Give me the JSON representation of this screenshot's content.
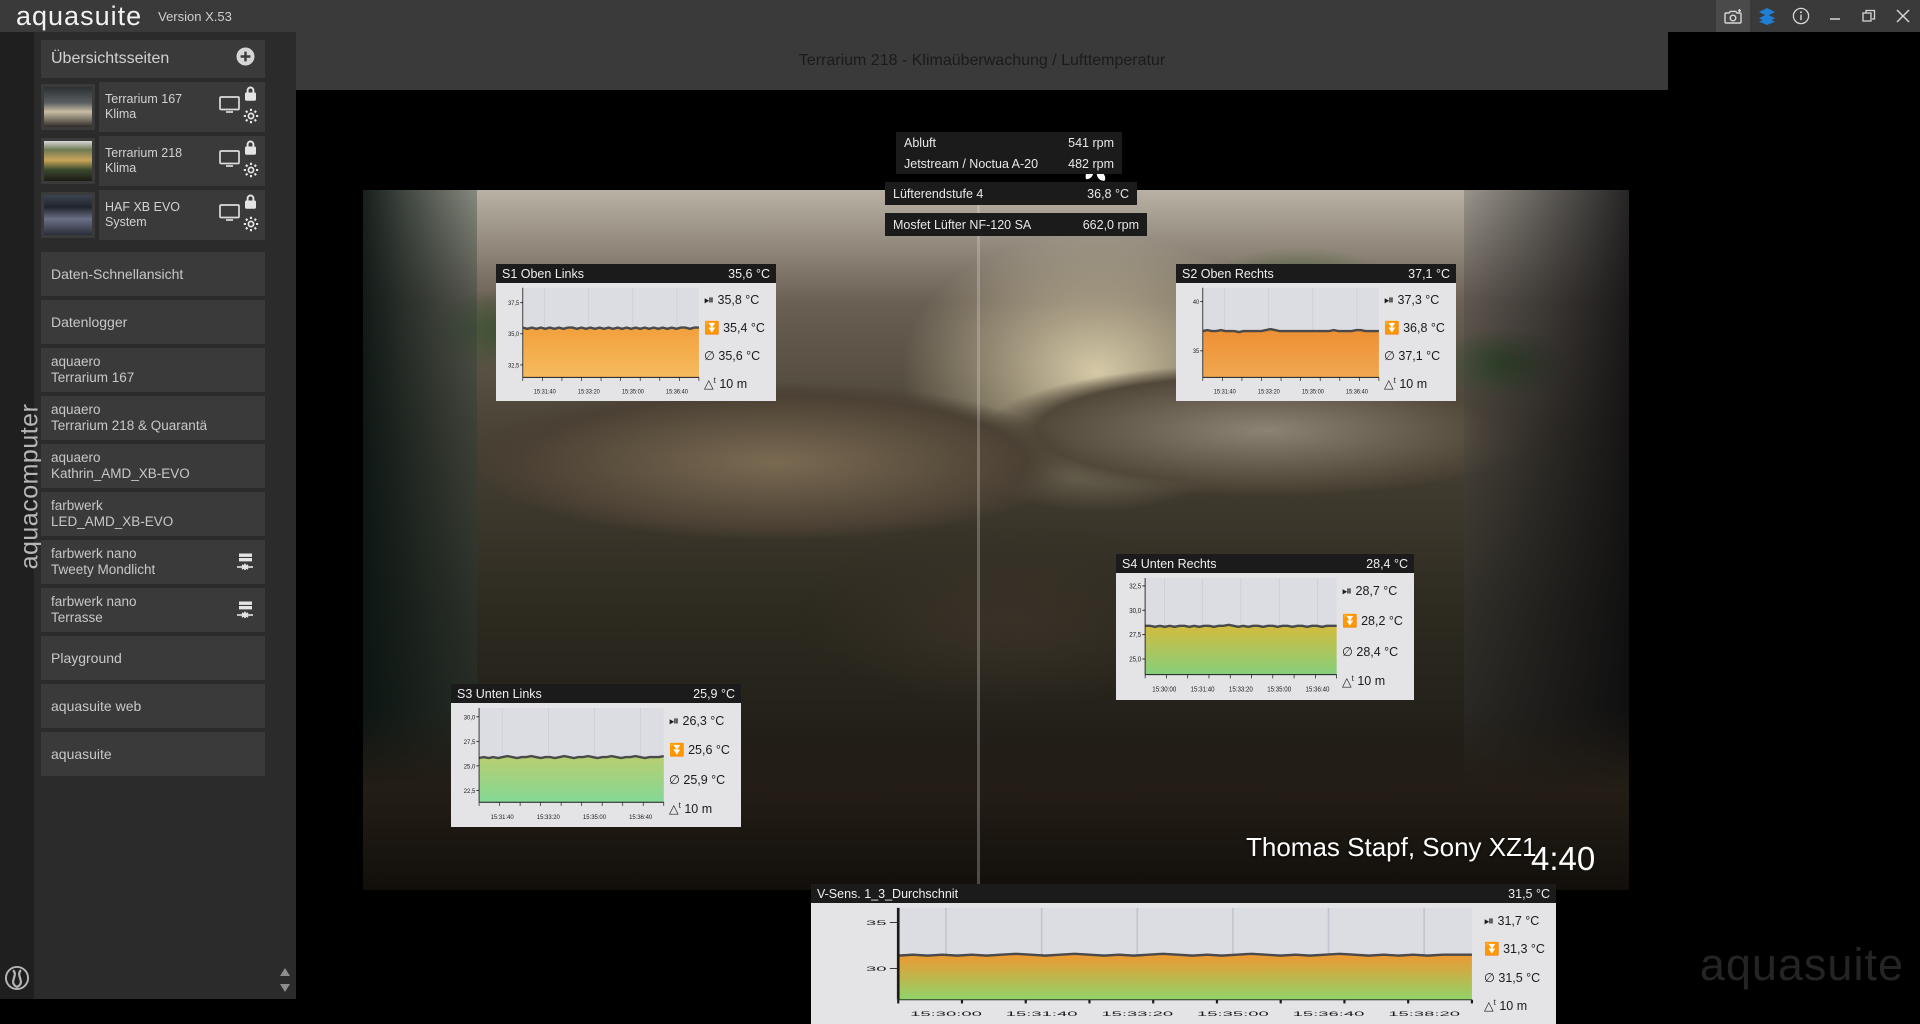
{
  "titlebar": {
    "app_name": "aquasuite",
    "version": "Version X.53",
    "buttons": [
      {
        "name": "screenshot-icon",
        "label": "Screenshot"
      },
      {
        "name": "layers-icon",
        "label": "Ebenen"
      },
      {
        "name": "info-icon",
        "label": "Info"
      },
      {
        "name": "minimize-icon",
        "label": "Minimieren"
      },
      {
        "name": "restore-icon",
        "label": "Wiederherstellen"
      },
      {
        "name": "close-icon",
        "label": "Schliessen"
      }
    ],
    "accent_blue": "#1e7fd4"
  },
  "sidebar": {
    "brand_vertical": "aquacomputer",
    "overview": {
      "title": "Übersichtsseiten",
      "add_label": "+"
    },
    "pages": [
      {
        "title": "Terrarium 167",
        "subtitle": "Klima"
      },
      {
        "title": "Terrarium 218",
        "subtitle": "Klima"
      },
      {
        "title": "HAF XB EVO",
        "subtitle": "System"
      }
    ],
    "sections": [
      {
        "label": "Daten-Schnellansicht"
      },
      {
        "label": "Datenlogger"
      }
    ],
    "devices": [
      {
        "type": "aquaero",
        "name": "Terrarium 167",
        "icon": ""
      },
      {
        "type": "aquaero",
        "name": "Terrarium 218 & Quarantä",
        "icon": ""
      },
      {
        "type": "aquaero",
        "name": "Kathrin_AMD_XB-EVO",
        "icon": ""
      },
      {
        "type": "farbwerk",
        "name": "LED_AMD_XB-EVO",
        "icon": ""
      },
      {
        "type": "farbwerk nano",
        "name": "Tweety Mondlicht",
        "icon": "device-icon"
      },
      {
        "type": "farbwerk nano",
        "name": "Terrasse",
        "icon": "device-icon"
      }
    ],
    "footer": [
      {
        "label": "Playground"
      },
      {
        "label": "aquasuite web"
      },
      {
        "label": "aquasuite"
      }
    ]
  },
  "main": {
    "header_title": "Terrarium 218 - Klimaüberwachung / Lufttemperatur",
    "watermark": "Thomas Stapf, Sony XZ1",
    "clock": "4:40",
    "brand_watermark": "aquasuite",
    "fan_icon": "fan-icon"
  },
  "data_labels": [
    {
      "name": "abluft",
      "label": "Abluft",
      "value": "541 rpm"
    },
    {
      "name": "jetstream",
      "label": "Jetstream / Noctua A-20",
      "value": "482 rpm"
    },
    {
      "name": "luefterendstufe",
      "label": "Lüfterendstufe 4",
      "value": "36,8 °C"
    },
    {
      "name": "mosfet",
      "label": "Mosfet Lüfter NF-120 SA",
      "value": "662,0 rpm"
    }
  ],
  "chart_data": [
    {
      "id": "s1",
      "type": "area",
      "title": "S1 Oben Links",
      "header_value": "35,6 °C",
      "ylabel": "",
      "xlabel": "",
      "yticks": [
        "37,5",
        "35,0",
        "32,5"
      ],
      "ytick_values": [
        37.5,
        35.0,
        32.5
      ],
      "ylim": [
        31.5,
        38.7
      ],
      "xticks": [
        "15:31:40",
        "15:33:20",
        "15:35:00",
        "15:36:40"
      ],
      "values": [
        35.5,
        35.4,
        35.5,
        35.4,
        35.5,
        35.4,
        35.5,
        35.4,
        35.5,
        35.4,
        35.5,
        35.5,
        35.4,
        35.5,
        35.4,
        35.5,
        35.4,
        35.5,
        35.4,
        35.5,
        35.4,
        35.5,
        35.4,
        35.5,
        35.4,
        35.5,
        35.4,
        35.5,
        35.4,
        35.5,
        35.4,
        35.5,
        35.4,
        35.5,
        35.4,
        35.5,
        35.5,
        35.4,
        35.5,
        35.5
      ],
      "stats": {
        "max_label": "35,8 °C",
        "min_label": "35,4 °C",
        "avg_label": "35,6 °C",
        "dt_label": "10 m"
      },
      "gradient": [
        "#f2a03c",
        "#f6bb5e"
      ]
    },
    {
      "id": "s2",
      "type": "area",
      "title": "S2 Oben Rechts",
      "header_value": "37,1 °C",
      "yticks": [
        "40",
        "35"
      ],
      "ytick_values": [
        40,
        35
      ],
      "ylim": [
        32.3,
        41.4
      ],
      "xticks": [
        "15:31:40",
        "15:33:20",
        "15:35:00",
        "15:36:40"
      ],
      "values": [
        37.0,
        37.1,
        37.0,
        37.0,
        37.1,
        37.0,
        37.0,
        37.0,
        36.9,
        37.0,
        37.0,
        37.0,
        37.0,
        37.0,
        37.1,
        37.2,
        37.1,
        37.0,
        37.0,
        37.0,
        37.0,
        37.0,
        37.0,
        37.0,
        37.0,
        37.0,
        37.0,
        37.0,
        37.0,
        37.1,
        37.0,
        37.0,
        37.0,
        37.0,
        37.1,
        37.1,
        37.0,
        37.0,
        37.0,
        37.0
      ],
      "stats": {
        "max_label": "37,3 °C",
        "min_label": "36,8 °C",
        "avg_label": "37,1 °C",
        "dt_label": "10 m"
      },
      "gradient": [
        "#ee8f33",
        "#f0a851"
      ]
    },
    {
      "id": "s4",
      "type": "area",
      "title": "S4 Unten Rechts",
      "header_value": "28,4 °C",
      "yticks": [
        "32,5",
        "30,0",
        "27,5",
        "25,0"
      ],
      "ytick_values": [
        32.5,
        30.0,
        27.5,
        25.0
      ],
      "ylim": [
        23.4,
        33.3
      ],
      "xticks": [
        "15:30:00",
        "15:31:40",
        "15:33:20",
        "15:35:00",
        "15:36:40"
      ],
      "values": [
        28.4,
        28.4,
        28.3,
        28.4,
        28.3,
        28.4,
        28.3,
        28.4,
        28.4,
        28.3,
        28.4,
        28.3,
        28.4,
        28.4,
        28.3,
        28.4,
        28.4,
        28.5,
        28.4,
        28.3,
        28.4,
        28.3,
        28.4,
        28.4,
        28.3,
        28.4,
        28.4,
        28.3,
        28.4,
        28.4,
        28.3,
        28.4,
        28.4,
        28.3,
        28.4,
        28.4,
        28.3,
        28.4,
        28.4,
        28.4
      ],
      "stats": {
        "max_label": "28,7 °C",
        "min_label": "28,2 °C",
        "avg_label": "28,4 °C",
        "dt_label": "10 m"
      },
      "gradient": [
        "#d4bb3c",
        "#86cf7c"
      ]
    },
    {
      "id": "s3",
      "type": "area",
      "title": "S3 Unten Links",
      "header_value": "25,9 °C",
      "yticks": [
        "30,0",
        "27,5",
        "25,0",
        "22,5"
      ],
      "ytick_values": [
        30.0,
        27.5,
        25.0,
        22.5
      ],
      "ylim": [
        21.3,
        30.9
      ],
      "xticks": [
        "15:31:40",
        "15:33:20",
        "15:35:00",
        "15:36:40"
      ],
      "values": [
        25.8,
        25.9,
        25.8,
        25.9,
        25.8,
        25.9,
        26.0,
        25.9,
        25.8,
        25.9,
        25.9,
        26.0,
        25.9,
        25.8,
        25.9,
        25.9,
        25.8,
        25.9,
        26.0,
        25.9,
        25.8,
        25.9,
        25.9,
        26.0,
        25.9,
        25.8,
        25.9,
        25.9,
        26.0,
        25.9,
        25.8,
        25.9,
        25.9,
        26.0,
        25.9,
        25.8,
        25.9,
        25.9,
        25.9,
        26.0
      ],
      "stats": {
        "max_label": "26,3 °C",
        "min_label": "25,6 °C",
        "avg_label": "25,9 °C",
        "dt_label": "10 m"
      },
      "gradient": [
        "#b9cf6f",
        "#84d896"
      ]
    },
    {
      "id": "vsens",
      "type": "area",
      "title": "V-Sens. 1_3_Durchschnit",
      "header_value": "31,5 °C",
      "yticks": [
        "35",
        "30"
      ],
      "ytick_values": [
        35,
        30
      ],
      "ylim": [
        26.6,
        36.6
      ],
      "xticks": [
        "15:30:00",
        "15:31:40",
        "15:33:20",
        "15:35:00",
        "15:36:40",
        "15:38:20"
      ],
      "values": [
        31.4,
        31.5,
        31.4,
        31.5,
        31.4,
        31.5,
        31.4,
        31.5,
        31.6,
        31.5,
        31.4,
        31.5,
        31.6,
        31.5,
        31.4,
        31.5,
        31.4,
        31.5,
        31.6,
        31.5,
        31.4,
        31.5,
        31.4,
        31.5,
        31.6,
        31.5,
        31.4,
        31.5,
        31.4,
        31.5,
        31.6,
        31.5,
        31.4,
        31.5,
        31.4,
        31.5,
        31.4,
        31.5,
        31.5,
        31.5
      ],
      "stats": {
        "max_label": "31,7 °C",
        "min_label": "31,3 °C",
        "avg_label": "31,5 °C",
        "dt_label": "10 m"
      },
      "gradient": [
        "#f0972f",
        "#8fd46a"
      ]
    }
  ]
}
